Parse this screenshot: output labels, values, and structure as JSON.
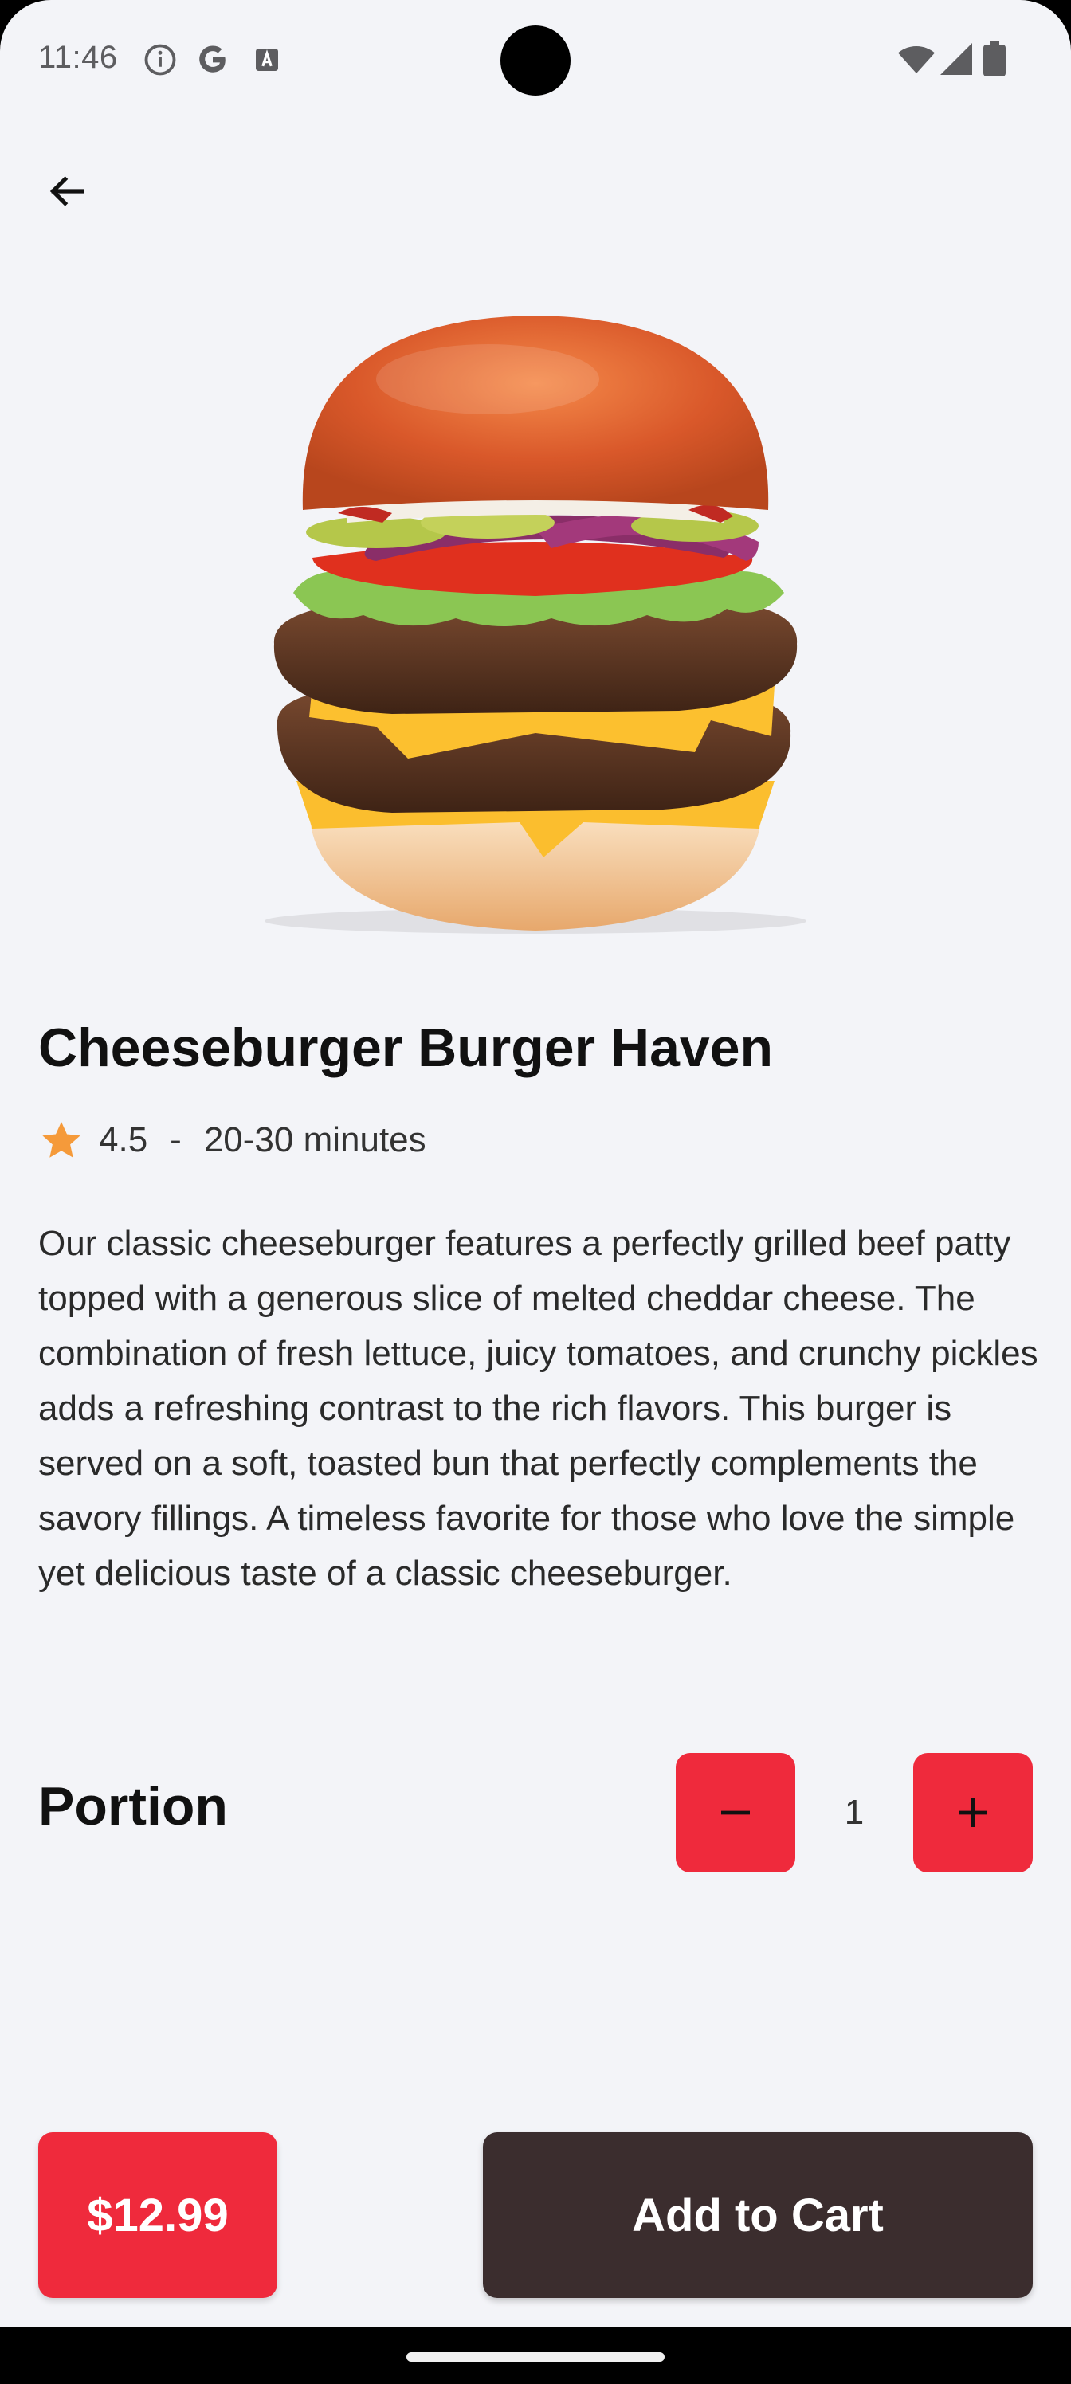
{
  "status_bar": {
    "time": "11:46"
  },
  "product": {
    "title": "Cheeseburger Burger Haven",
    "rating": "4.5",
    "separator": "-",
    "delivery_time": "20-30 minutes",
    "description": "Our classic cheeseburger features a perfectly grilled beef patty topped with a generous slice of melted cheddar cheese. The combination of fresh lettuce, juicy tomatoes, and crunchy pickles adds a refreshing contrast to the rich flavors. This burger is served on a soft, toasted bun that perfectly complements the savory fillings. A timeless favorite for those who love the simple yet delicious taste of a classic cheeseburger."
  },
  "portion": {
    "label": "Portion",
    "quantity": "1"
  },
  "footer": {
    "price": "$12.99",
    "add_to_cart_label": "Add to Cart"
  },
  "icons": {
    "back": "arrow-back-icon",
    "star": "star-icon",
    "minus": "minus-icon",
    "plus": "plus-icon"
  },
  "colors": {
    "accent": "#ef2a3c",
    "cart_button": "#3b2d2e",
    "star": "#f59a3a",
    "background": "#f3f4f8"
  }
}
